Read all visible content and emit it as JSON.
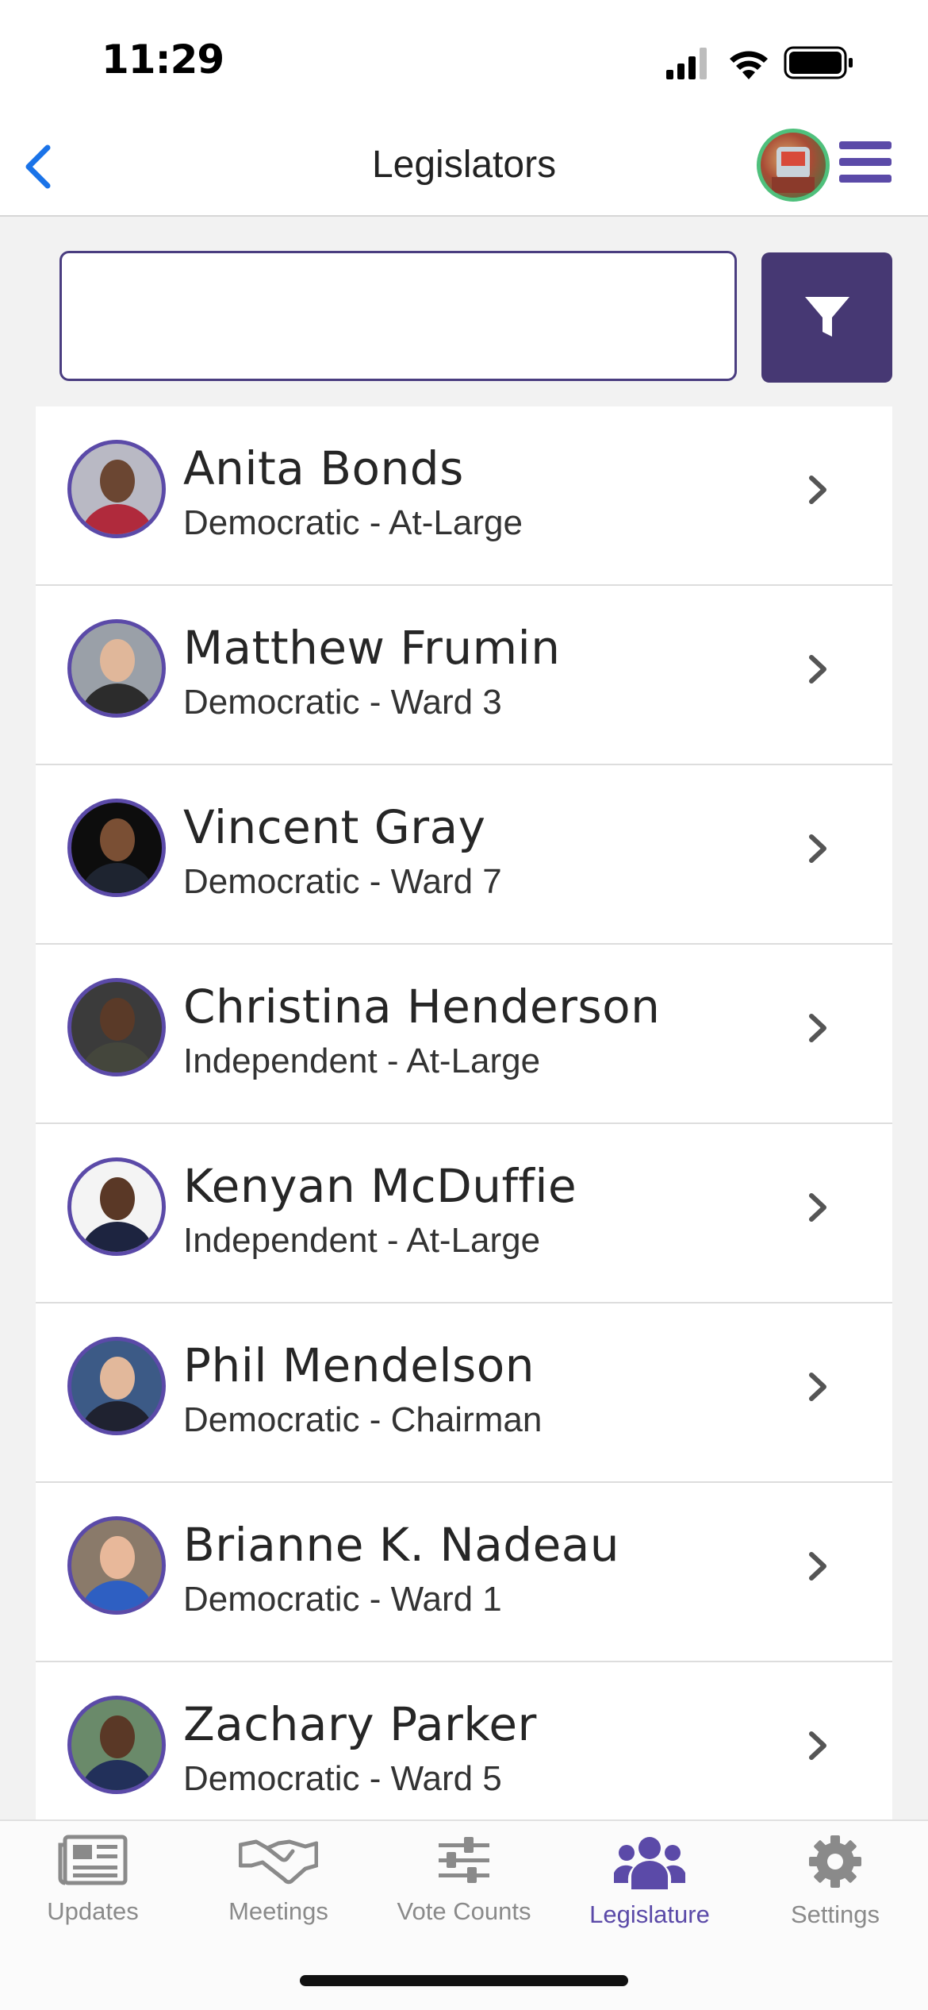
{
  "status_bar": {
    "time": "11:29"
  },
  "nav": {
    "title": "Legislators"
  },
  "search": {
    "value": "",
    "placeholder": ""
  },
  "legislators": [
    {
      "name": "Anita Bonds",
      "subtitle": "Democratic - At-Large"
    },
    {
      "name": "Matthew Frumin",
      "subtitle": "Democratic - Ward 3"
    },
    {
      "name": "Vincent Gray",
      "subtitle": "Democratic - Ward 7"
    },
    {
      "name": "Christina Henderson",
      "subtitle": "Independent - At-Large"
    },
    {
      "name": "Kenyan McDuffie",
      "subtitle": "Independent - At-Large"
    },
    {
      "name": "Phil Mendelson",
      "subtitle": "Democratic - Chairman"
    },
    {
      "name": "Brianne K. Nadeau",
      "subtitle": "Democratic - Ward 1"
    },
    {
      "name": "Zachary Parker",
      "subtitle": "Democratic - Ward 5"
    }
  ],
  "tabs": [
    {
      "label": "Updates",
      "icon": "newspaper-icon",
      "active": false
    },
    {
      "label": "Meetings",
      "icon": "handshake-icon",
      "active": false
    },
    {
      "label": "Vote Counts",
      "icon": "sliders-icon",
      "active": false
    },
    {
      "label": "Legislature",
      "icon": "users-icon",
      "active": true
    },
    {
      "label": "Settings",
      "icon": "gear-icon",
      "active": false
    }
  ],
  "colors": {
    "accent": "#5b4aa8",
    "filter_button": "#463873",
    "back_arrow": "#1a73e8",
    "inactive_tab": "#8a8a8a"
  }
}
